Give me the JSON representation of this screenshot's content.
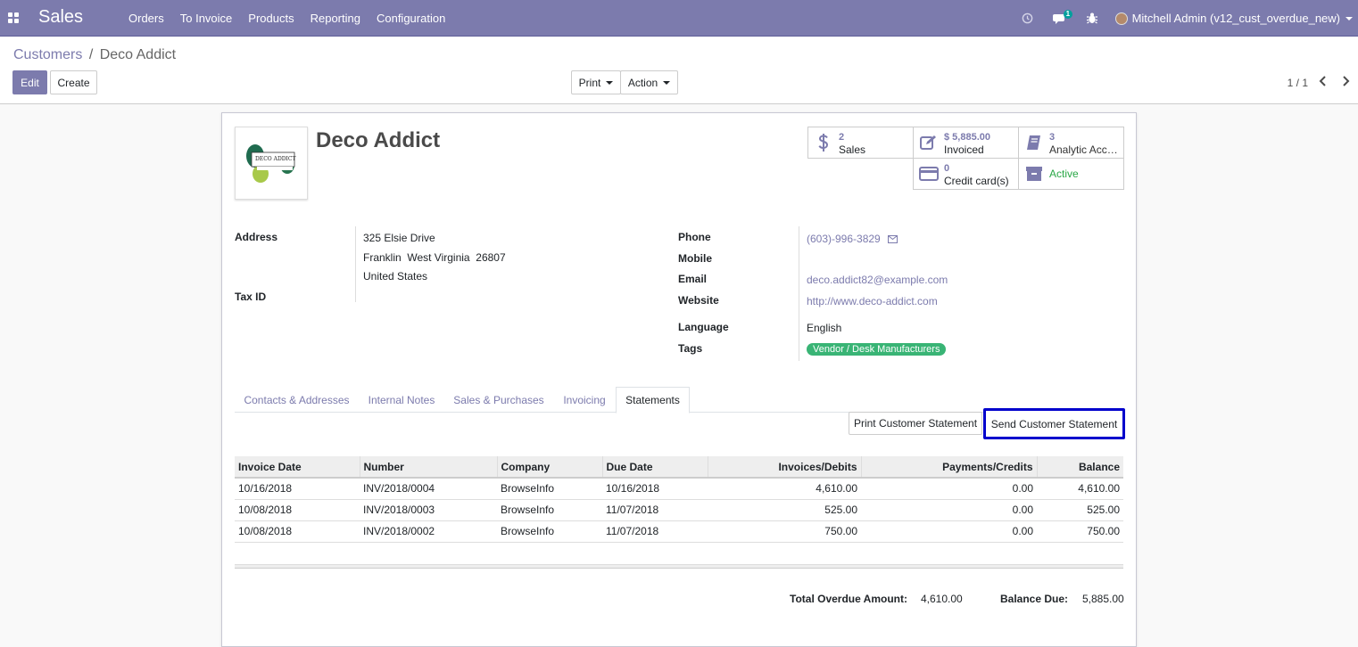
{
  "app": {
    "brand": "Sales"
  },
  "menu": [
    "Orders",
    "To Invoice",
    "Products",
    "Reporting",
    "Configuration"
  ],
  "user": {
    "name": "Mitchell Admin (v12_cust_overdue_new)",
    "chat_badge": "1"
  },
  "breadcrumb": {
    "parent": "Customers",
    "separator": "/",
    "current": "Deco Addict"
  },
  "buttons": {
    "edit": "Edit",
    "create": "Create",
    "print": "Print",
    "action": "Action"
  },
  "pager": {
    "value": "1 / 1"
  },
  "partner": {
    "name": "Deco Addict",
    "logo_text": "DECO ADDICT"
  },
  "stats": {
    "sales": {
      "value": "2",
      "label": "Sales"
    },
    "invoiced": {
      "value": "$ 5,885.00",
      "label": "Invoiced"
    },
    "analytic": {
      "value": "3",
      "label": "Analytic Accounts"
    },
    "credit_cards": {
      "value": "0",
      "label": "Credit card(s)"
    },
    "active": {
      "label": "Active"
    }
  },
  "fields": {
    "address_label": "Address",
    "address_street": "325 Elsie Drive",
    "address_city_line": "Franklin  West Virginia  26807",
    "address_country": "United States",
    "tax_label": "Tax ID",
    "phone_label": "Phone",
    "phone": "(603)-996-3829",
    "mobile_label": "Mobile",
    "email_label": "Email",
    "email": "deco.addict82@example.com",
    "website_label": "Website",
    "website": "http://www.deco-addict.com",
    "language_label": "Language",
    "language": "English",
    "tags_label": "Tags",
    "tag": "Vendor / Desk Manufacturers"
  },
  "tabs": [
    "Contacts & Addresses",
    "Internal Notes",
    "Sales & Purchases",
    "Invoicing",
    "Statements"
  ],
  "statement_buttons": {
    "print": "Print Customer Statement",
    "send": "Send Customer Statement"
  },
  "statement_table": {
    "headers": [
      "Invoice Date",
      "Number",
      "Company",
      "Due Date",
      "Invoices/Debits",
      "Payments/Credits",
      "Balance"
    ],
    "rows": [
      [
        "10/16/2018",
        "INV/2018/0004",
        "BrowseInfo",
        "10/16/2018",
        "4,610.00",
        "0.00",
        "4,610.00"
      ],
      [
        "10/08/2018",
        "INV/2018/0003",
        "BrowseInfo",
        "11/07/2018",
        "525.00",
        "0.00",
        "525.00"
      ],
      [
        "10/08/2018",
        "INV/2018/0002",
        "BrowseInfo",
        "11/07/2018",
        "750.00",
        "0.00",
        "750.00"
      ]
    ]
  },
  "totals": {
    "overdue_label": "Total Overdue Amount:",
    "overdue_value": "4,610.00",
    "balance_label": "Balance Due:",
    "balance_value": "5,885.00"
  },
  "colors": {
    "brand": "#7c7bad",
    "tag": "#39b475",
    "highlight": "#0000cc"
  }
}
